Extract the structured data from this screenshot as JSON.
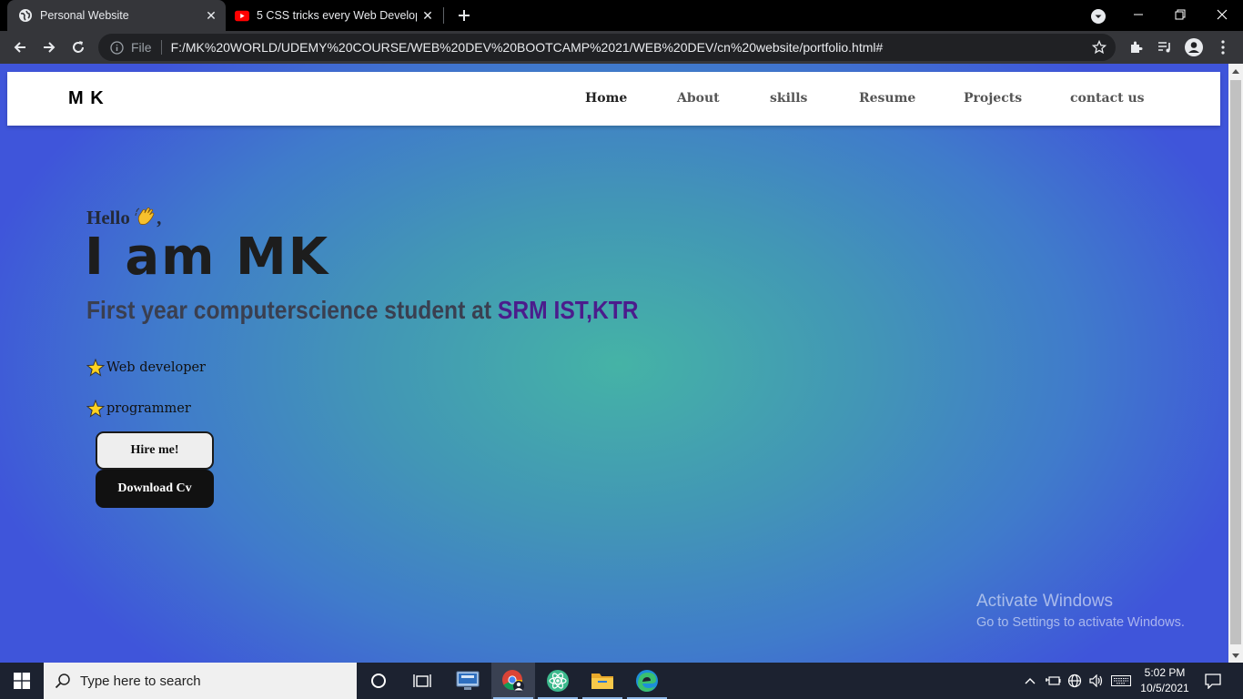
{
  "browser": {
    "tabs": [
      {
        "title": "Personal Website",
        "active": true
      },
      {
        "title": "5 CSS tricks every Web Developer",
        "active": false
      }
    ],
    "omnibox": {
      "scheme_label": "File",
      "url": "F:/MK%20WORLD/UDEMY%20COURSE/WEB%20DEV%20BOOTCAMP%2021/WEB%20DEV/cn%20website/portfolio.html#"
    }
  },
  "page": {
    "logo": "M K",
    "nav": [
      "Home",
      "About",
      "skills",
      "Resume",
      "Projects",
      "contact us"
    ],
    "greeting": "Hello",
    "greeting_suffix": ",",
    "headline": "I am MK",
    "tagline_prefix": "First year computerscience student at ",
    "tagline_college": "SRM IST,KTR",
    "roles": [
      "Web developer",
      "programmer"
    ],
    "buttons": {
      "hire": "Hire me!",
      "cv": "Download Cv"
    },
    "colors": {
      "tagline": "#3a3f50",
      "college": "#4b1c8c",
      "gradient_center": "#45b3a6",
      "gradient_edge": "#3f55da"
    }
  },
  "watermark": {
    "line1": "Activate Windows",
    "line2": "Go to Settings to activate Windows."
  },
  "taskbar": {
    "search_placeholder": "Type here to search",
    "pinned": [
      "cortana-icon",
      "task-view-icon",
      "remote-desktop-icon",
      "chrome-icon",
      "atom-icon",
      "file-explorer-icon",
      "edge-icon"
    ],
    "time": "5:02 PM",
    "date": "10/5/2021"
  }
}
